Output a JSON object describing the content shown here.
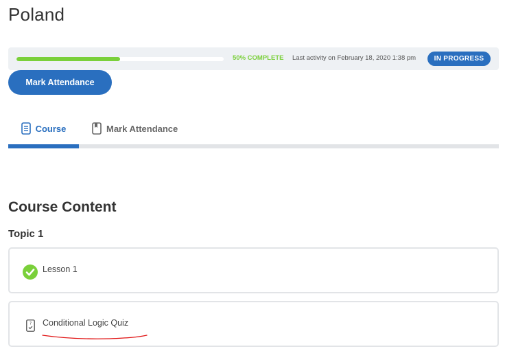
{
  "page": {
    "title": "Poland"
  },
  "status": {
    "progress_label": "50% COMPLETE",
    "progress_value": 0.5,
    "last_activity": "Last activity on February 18, 2020 1:38 pm",
    "badge": "IN PROGRESS",
    "accent_color": "#2a6fbf",
    "progress_color": "#7ad03a"
  },
  "actions": {
    "mark_attendance": "Mark Attendance"
  },
  "tabs": [
    {
      "label": "Course",
      "icon": "document-icon",
      "active": true
    },
    {
      "label": "Mark Attendance",
      "icon": "bookmark-icon",
      "active": false
    }
  ],
  "content": {
    "heading": "Course Content",
    "topic": "Topic 1",
    "items": [
      {
        "label": "Lesson 1",
        "icon": "check-circle-icon",
        "completed": true
      },
      {
        "label": "Conditional Logic Quiz",
        "icon": "quiz-icon",
        "completed": false
      }
    ]
  }
}
